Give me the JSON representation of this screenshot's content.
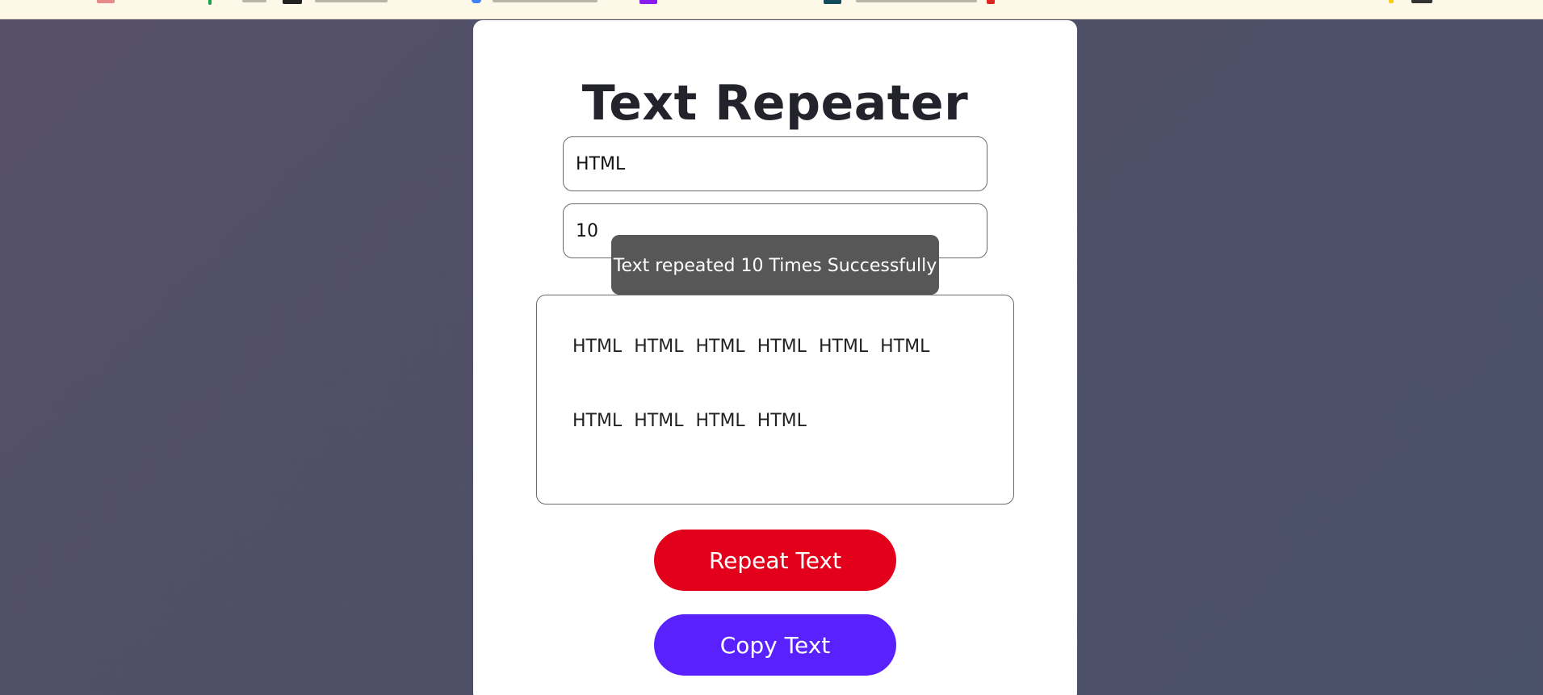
{
  "app": {
    "title": "Text Repeater"
  },
  "inputs": {
    "text_value": "HTML",
    "count_value": "10"
  },
  "toast": {
    "message": "Text repeated 10 Times Successfully"
  },
  "output": {
    "words": [
      "HTML",
      "HTML",
      "HTML",
      "HTML",
      "HTML",
      "HTML",
      "HTML",
      "HTML",
      "HTML",
      "HTML"
    ]
  },
  "buttons": {
    "repeat_label": "Repeat Text",
    "copy_label": "Copy Text"
  },
  "colors": {
    "repeat_button": "#e2001a",
    "copy_button": "#5a21ff",
    "toast_background": "#575757"
  }
}
